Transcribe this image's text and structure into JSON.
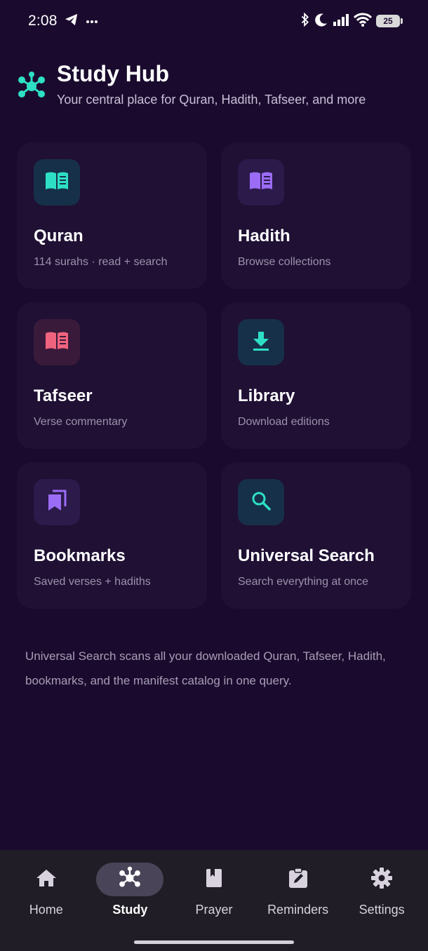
{
  "status_bar": {
    "time": "2:08",
    "battery": "25"
  },
  "header": {
    "title": "Study Hub",
    "subtitle": "Your central place for Quran, Hadith, Tafseer, and more"
  },
  "cards": [
    {
      "title": "Quran",
      "desc": "114 surahs · read + search",
      "icon": "book-open-icon",
      "color": "#2de0c5",
      "bg": "#17304a"
    },
    {
      "title": "Hadith",
      "desc": "Browse collections",
      "icon": "book-open-icon",
      "color": "#9b6cf5",
      "bg": "#2b1a4a"
    },
    {
      "title": "Tafseer",
      "desc": "Verse commentary",
      "icon": "book-open-icon",
      "color": "#f0637f",
      "bg": "#3a1a3a"
    },
    {
      "title": "Library",
      "desc": "Download editions",
      "icon": "download-icon",
      "color": "#2de0c5",
      "bg": "#17304a"
    },
    {
      "title": "Bookmarks",
      "desc": "Saved verses + hadiths",
      "icon": "bookmarks-icon",
      "color": "#9b6cf5",
      "bg": "#2b1a4a"
    },
    {
      "title": "Universal Search",
      "desc": "Search everything at once",
      "icon": "search-icon",
      "color": "#2de0c5",
      "bg": "#17304a"
    }
  ],
  "footnote": "Universal Search scans all your downloaded Quran, Tafseer, Hadith, bookmarks, and the manifest catalog in one query.",
  "nav": [
    {
      "label": "Home",
      "icon": "home-icon"
    },
    {
      "label": "Study",
      "icon": "hub-icon",
      "active": true
    },
    {
      "label": "Prayer",
      "icon": "book-icon"
    },
    {
      "label": "Reminders",
      "icon": "clipboard-edit-icon"
    },
    {
      "label": "Settings",
      "icon": "gear-icon"
    }
  ],
  "colors": {
    "background": "#1a0b2e",
    "card": "#1f1034",
    "accent": "#2de0c5",
    "nav_bg": "#201d26"
  }
}
